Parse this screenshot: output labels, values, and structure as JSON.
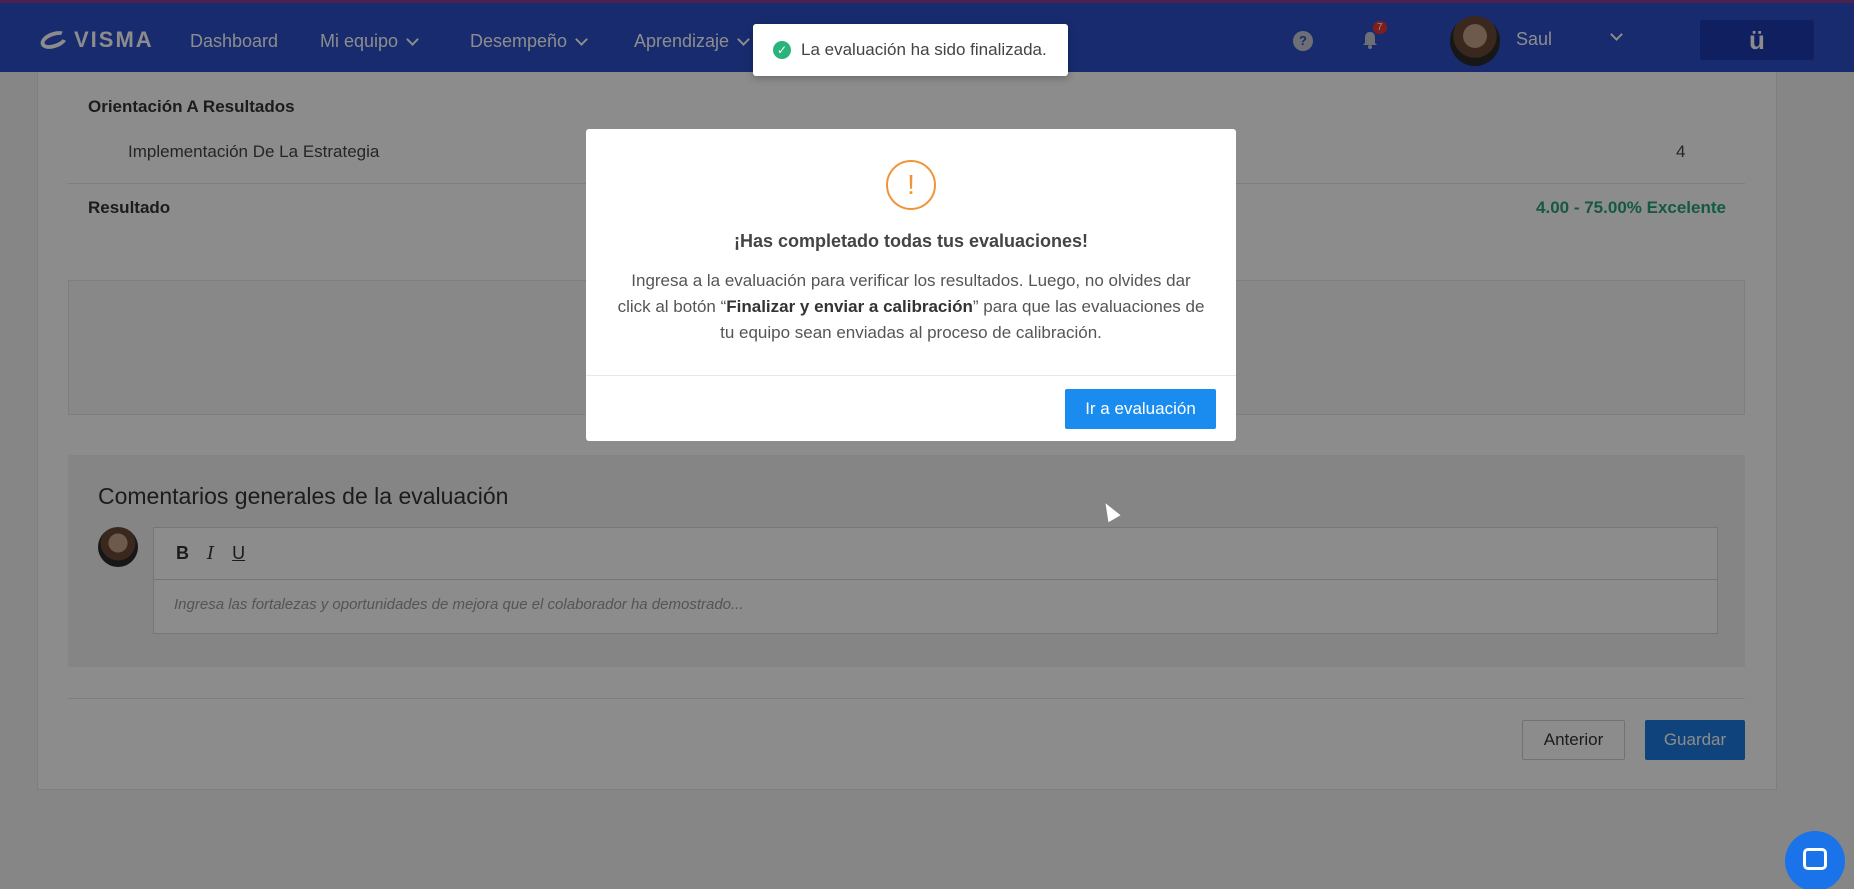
{
  "nav": {
    "logo": "VISMA",
    "items": [
      {
        "label": "Dashboard"
      },
      {
        "label": "Mi equipo"
      },
      {
        "label": "Desempeño"
      },
      {
        "label": "Aprendizaje"
      }
    ],
    "help": "?",
    "notifications_count": "7",
    "user_name": "Saul",
    "app_button": "ü"
  },
  "evaluation": {
    "section": "Orientación A Resultados",
    "item_label": "Implementación De La Estrategia",
    "item_value": "4",
    "result_label": "Resultado",
    "result_value": "4.00 - 75.00% Excelente"
  },
  "comments": {
    "title": "Comentarios generales de la evaluación",
    "toolbar": {
      "bold": "B",
      "italic": "I",
      "underline": "U"
    },
    "placeholder": "Ingresa las fortalezas y oportunidades de mejora que el colaborador ha demostrado..."
  },
  "footer": {
    "prev_label": "Anterior",
    "save_label": "Guardar"
  },
  "modal": {
    "icon": "!",
    "title": "¡Has completado todas tus evaluaciones!",
    "body_1": "Ingresa a la evaluación para verificar los resultados. Luego, no olvides dar click al botón “",
    "body_bold": "Finalizar y enviar a calibración",
    "body_2": "” para que las evaluaciones de tu equipo sean enviadas al proceso de calibración.",
    "button": "Ir a evaluación"
  },
  "toast": {
    "message": "La evaluación ha sido finalizada."
  },
  "colors": {
    "nav_bg": "#2a4fc9",
    "accent": "#1a8cf0",
    "success": "#2bb37d",
    "warning": "#f0943a",
    "result": "#27a37a"
  }
}
